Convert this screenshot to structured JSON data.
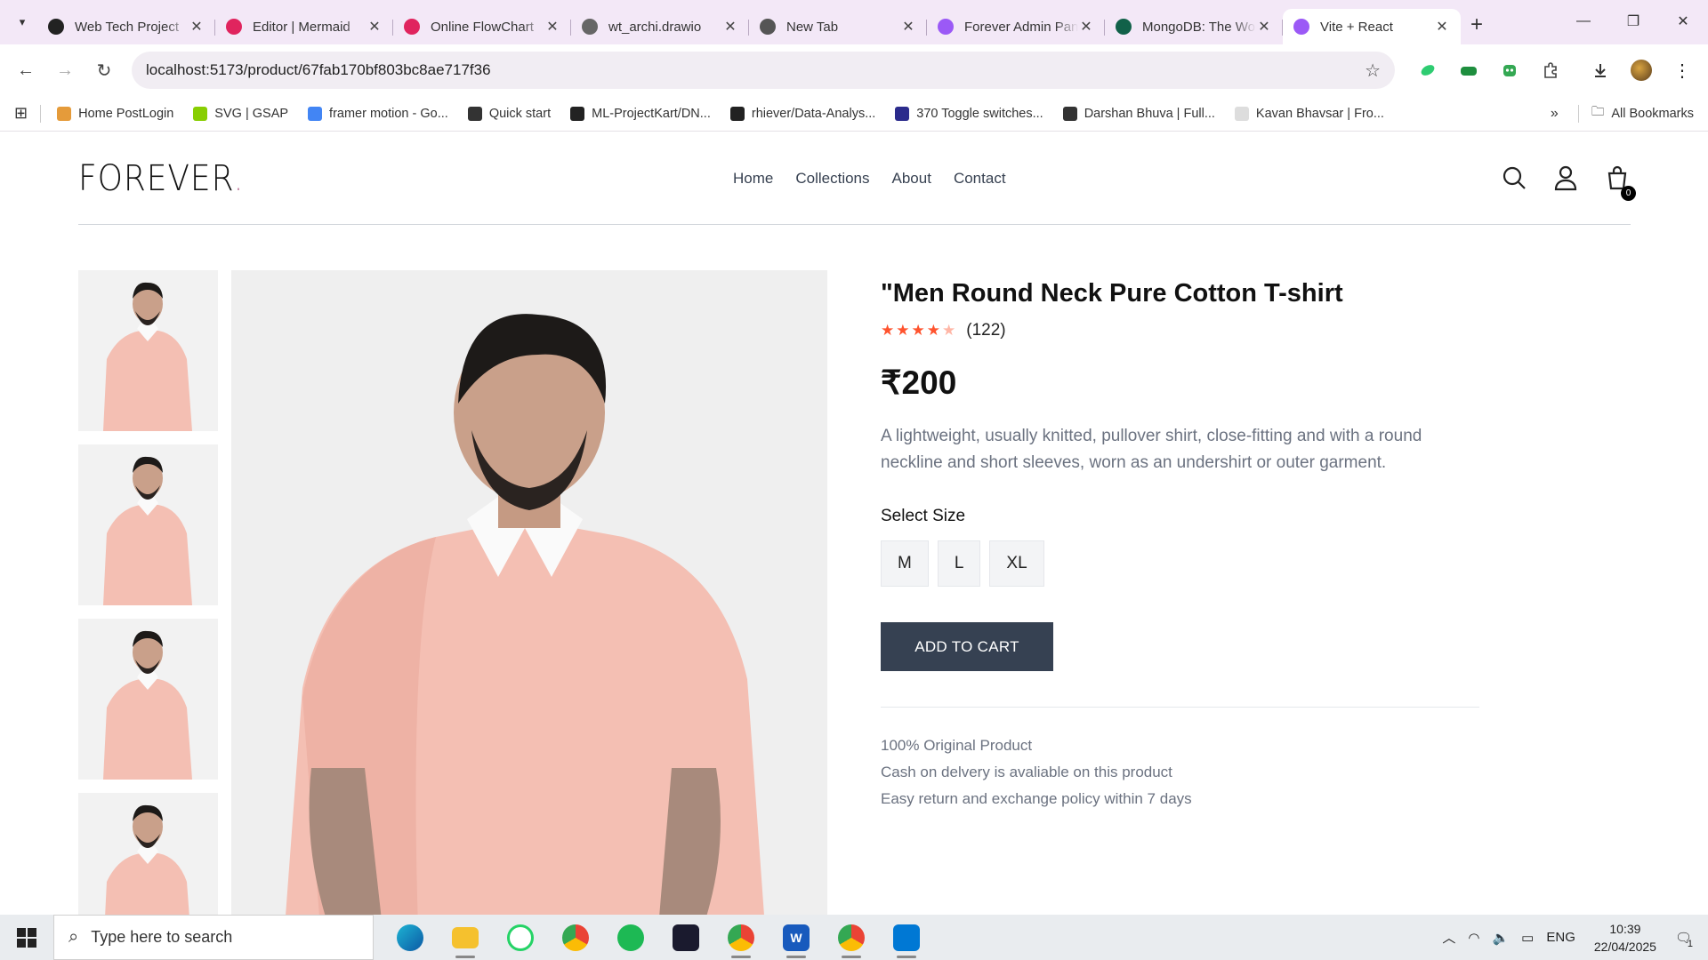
{
  "browser": {
    "tabs": [
      {
        "title": "Web Tech Project",
        "favicon_color": "#222222",
        "active": false
      },
      {
        "title": "Editor | Mermaid",
        "favicon_color": "#e0245e",
        "active": false
      },
      {
        "title": "Online FlowChart",
        "favicon_color": "#e0245e",
        "active": false
      },
      {
        "title": "wt_archi.drawio",
        "favicon_color": "#666666",
        "active": false
      },
      {
        "title": "New Tab",
        "favicon_color": "#555555",
        "active": false
      },
      {
        "title": "Forever Admin Panel",
        "favicon_color": "#9b59f6",
        "active": false
      },
      {
        "title": "MongoDB: The World",
        "favicon_color": "#116149",
        "active": false
      },
      {
        "title": "Vite + React",
        "favicon_color": "#9b59f6",
        "active": true
      }
    ],
    "url": "localhost:5173/product/67fab170bf803bc8ae717f36",
    "bookmarks": [
      {
        "label": "Home PostLogin",
        "color": "#e59b3a"
      },
      {
        "label": "SVG | GSAP",
        "color": "#88ce02"
      },
      {
        "label": "framer motion - Go...",
        "color": "#4285f4"
      },
      {
        "label": "Quick start",
        "color": "#333333"
      },
      {
        "label": "ML-ProjectKart/DN...",
        "color": "#222222"
      },
      {
        "label": "rhiever/Data-Analys...",
        "color": "#222222"
      },
      {
        "label": "370 Toggle switches...",
        "color": "#2b2b8c"
      },
      {
        "label": "Darshan Bhuva | Full...",
        "color": "#333333"
      },
      {
        "label": "Kavan Bhavsar | Fro...",
        "color": "#dddddd"
      }
    ],
    "all_bookmarks": "All Bookmarks"
  },
  "shop": {
    "logo": "FOREVER",
    "logo_dot": ".",
    "menu": [
      "Home",
      "Collections",
      "About",
      "Contact"
    ],
    "cart_count": "0",
    "product": {
      "title": "\"Men Round Neck Pure Cotton T-shirt",
      "rating": 4,
      "rating_max": 5,
      "reviews": "(122)",
      "price": "₹200",
      "description": "A lightweight, usually knitted, pullover shirt, close-fitting and with a round neckline and short sleeves, worn as an undershirt or outer garment.",
      "select_size_label": "Select Size",
      "sizes": [
        "M",
        "L",
        "XL"
      ],
      "add_to_cart": "ADD TO CART",
      "policies": [
        "100% Original Product",
        "Cash on delvery is avaliable on this product",
        "Easy return and exchange policy within 7 days"
      ]
    }
  },
  "taskbar": {
    "search_placeholder": "Type here to search",
    "language": "ENG",
    "time": "10:39",
    "date": "22/04/2025",
    "notification_count": "1"
  }
}
